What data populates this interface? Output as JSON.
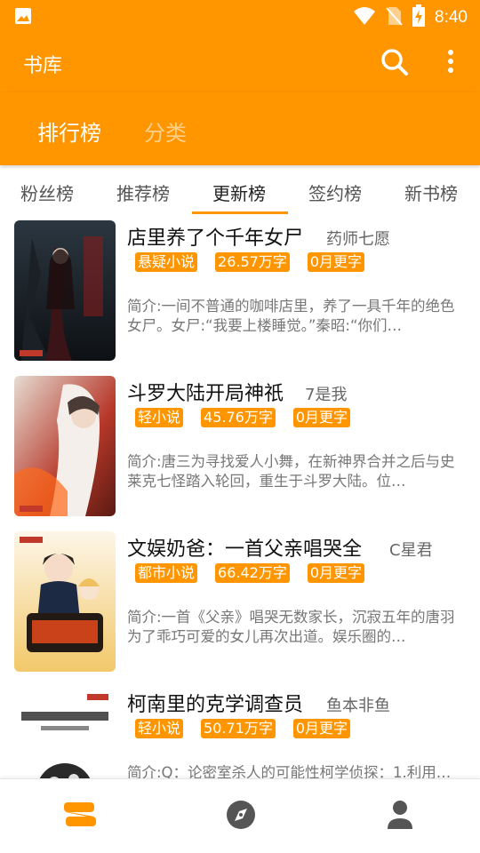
{
  "status_bar": {
    "time": "8:40",
    "icons": [
      "image-icon",
      "wifi-icon",
      "no-sim-icon",
      "battery-charging-icon"
    ]
  },
  "app_bar": {
    "title": "书库",
    "icons": [
      "search-icon",
      "more-vert-icon"
    ]
  },
  "top_tabs": [
    {
      "label": "排行榜",
      "active": true
    },
    {
      "label": "分类",
      "active": false
    }
  ],
  "sub_tabs": [
    {
      "label": "粉丝榜",
      "active": false
    },
    {
      "label": "推荐榜",
      "active": false
    },
    {
      "label": "更新榜",
      "active": true
    },
    {
      "label": "签约榜",
      "active": false
    },
    {
      "label": "新书榜",
      "active": false
    }
  ],
  "books": [
    {
      "title": "店里养了个千年女尸",
      "author": "药师七愿",
      "tags": [
        "悬疑小说",
        "26.57万字",
        "0月更字"
      ],
      "intro": "简介:一间不普通的咖啡店里，养了一具千年的绝色女尸。女尸:“我要上楼睡觉。”秦昭:“你们…"
    },
    {
      "title": "斗罗大陆开局神祇",
      "author": "7是我",
      "tags": [
        "轻小说",
        "45.76万字",
        "0月更字"
      ],
      "intro": "简介:唐三为寻找爱人小舞，在新神界合并之后与史莱克七怪踏入轮回，重生于斗罗大陆。位…"
    },
    {
      "title": "文娱奶爸：一首父亲唱哭全",
      "author": "C星君",
      "tags": [
        "都市小说",
        "66.42万字",
        "0月更字"
      ],
      "intro": "简介:一首《父亲》唱哭无数家长，沉寂五年的唐羽为了乖巧可爱的女儿再次出道。娱乐圈的…"
    },
    {
      "title": "柯南里的克学调查员",
      "author": "鱼本非鱼",
      "tags": [
        "轻小说",
        "50.71万字",
        "0月更字"
      ],
      "intro": "简介:Q：论密室杀人的可能性柯学侦探：1.利用…"
    }
  ],
  "bottom_nav": [
    {
      "icon": "bookshelf-icon",
      "active": true
    },
    {
      "icon": "compass-icon",
      "active": false
    },
    {
      "icon": "person-icon",
      "active": false
    }
  ],
  "colors": {
    "accent": "#ff9600",
    "tab_inactive": "#ffd08a",
    "text_primary": "#111111",
    "text_secondary": "#777777"
  }
}
